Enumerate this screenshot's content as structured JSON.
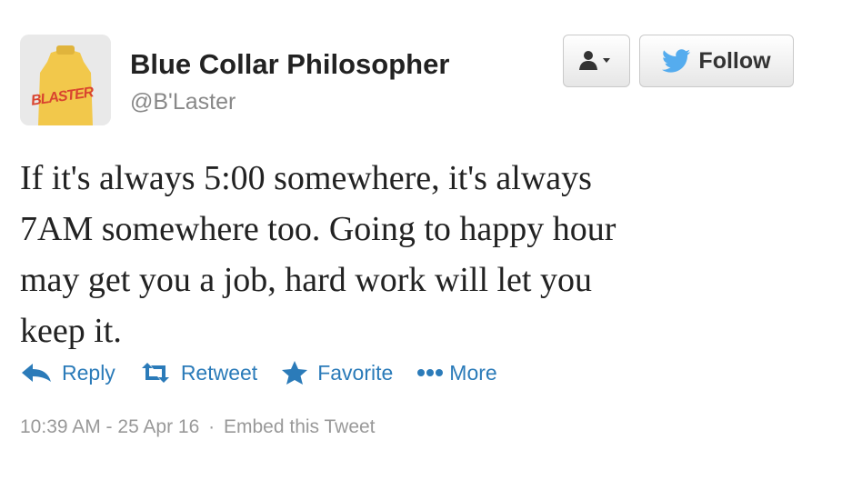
{
  "author": {
    "avatar_text": "BLASTER",
    "name": "Blue Collar Philosopher",
    "handle": "@B'Laster"
  },
  "buttons": {
    "user_menu_icon": "user-dropdown-icon",
    "follow_label": "Follow"
  },
  "tweet": {
    "lines": [
      "If it's always 5:00 somewhere, it's always",
      "7AM somewhere too. Going to happy hour",
      "may get you a job, hard work will let you",
      "keep it."
    ]
  },
  "actions": {
    "reply": "Reply",
    "retweet": "Retweet",
    "favorite": "Favorite",
    "more": "More"
  },
  "meta": {
    "timestamp": "10:39 AM - 25 Apr 16",
    "separator": "·",
    "embed": "Embed this Tweet"
  },
  "colors": {
    "link": "#2b7bb9",
    "twitter_blue": "#55acee",
    "avatar_yellow": "#f2c84b",
    "avatar_red": "#d9442f"
  }
}
